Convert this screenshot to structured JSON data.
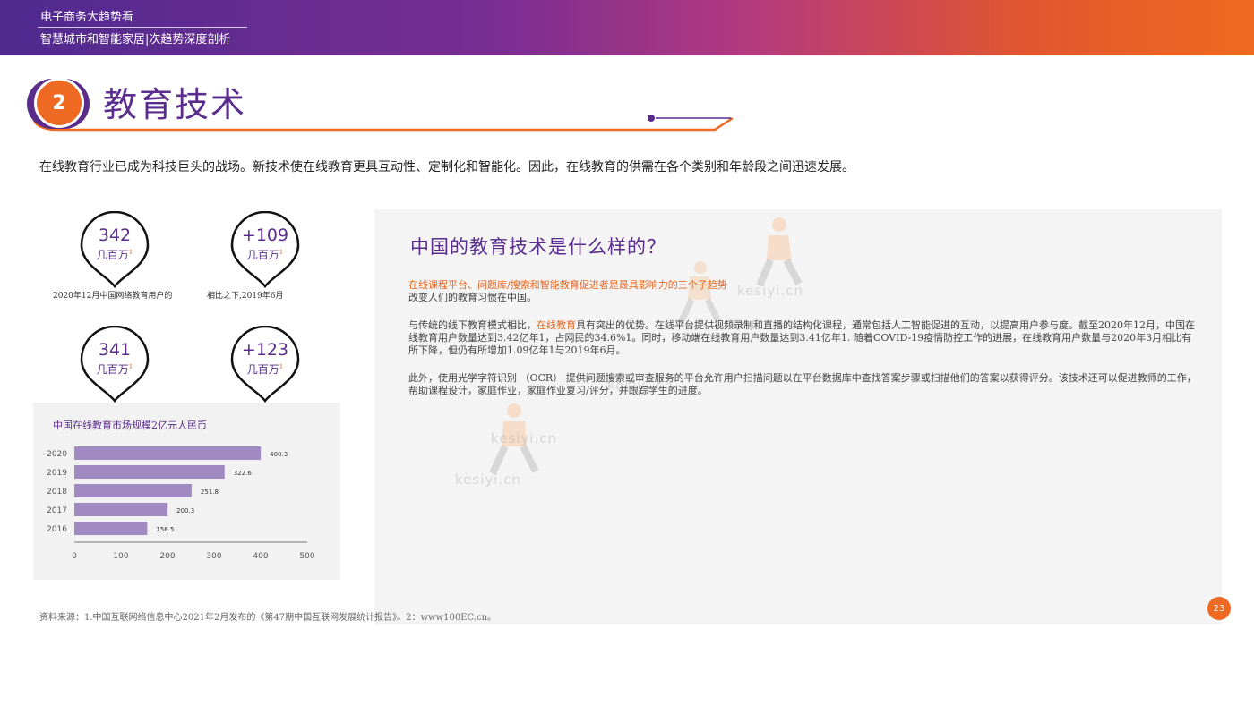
{
  "header": {
    "line1": "电子商务大趋势看",
    "line2": "智慧城市和智能家居|次趋势深度剖析"
  },
  "section": {
    "number": "2",
    "title": "教育技术"
  },
  "intro": "在线教育行业已成为科技巨头的战场。新技术使在线教育更具互动性、定制化和智能化。因此，在线教育的供需在各个类别和年龄段之间迅速发展。",
  "stats": [
    {
      "value": "342",
      "unit": "几百万",
      "note": "1"
    },
    {
      "value": "+109",
      "unit": "几百万",
      "note": "1"
    },
    {
      "value": "341",
      "unit": "几百万",
      "note": "1"
    },
    {
      "value": "+123",
      "unit": "几百万",
      "note": "1"
    }
  ],
  "captions": {
    "c1": "2020年12月中国网络教育用户的",
    "c2": "相比之下,2019年6月"
  },
  "chart_data": {
    "type": "bar",
    "orientation": "horizontal",
    "title": "中国在线教育市场规模2亿元人民币",
    "categories": [
      "2020",
      "2019",
      "2018",
      "2017",
      "2016"
    ],
    "values": [
      400.3,
      322.6,
      251.8,
      200.3,
      156.5
    ],
    "xlim": [
      0,
      500
    ],
    "xticks": [
      "0",
      "100",
      "200",
      "300",
      "400",
      "500"
    ],
    "bar_color": "#a189c2",
    "grid": false
  },
  "panel": {
    "title": "中国的教育技术是什么样的？",
    "p1_highlight": "在线课程平台、问题库/搜索和智能教育促进者是最具影响力的三个子趋势",
    "p1_rest": "改变人们的教育习惯在中国。",
    "p2_a": "与传统的线下教育模式相比，",
    "p2_highlight": "在线教育",
    "p2_b": "具有突出的优势。在线平台提供视频录制和直播的结构化课程，通常包括人工智能促进的互动，以提高用户参与度。截至2020年12月，中国在线教育用户数量达到3.42亿年1，占网民的34.6%1。同时，移动端在线教育用户数量达到3.41亿年1. 随着COVID-19疫情防控工作的进展，在线教育用户数量与2020年3月相比有所下降，但仍有所增加1.09亿年1与2019年6月。",
    "p3": "此外，使用光学字符识别 （OCR） 提供问题搜索或审查服务的平台允许用户扫描问题以在平台数据库中查找答案步骤或扫描他们的答案以获得评分。该技术还可以促进教师的工作，帮助课程设计，家庭作业，家庭作业复习/评分，并跟踪学生的进度。"
  },
  "watermark": "kesiyi.cn",
  "source": "资料来源：1.中国互联网络信息中心2021年2月发布的《第47期中国互联网发展统计报告》。2：www100EC.cn。",
  "page_number": "23",
  "colors": {
    "purple": "#5a2d8c",
    "orange": "#ee6a22",
    "bar": "#a189c2"
  }
}
